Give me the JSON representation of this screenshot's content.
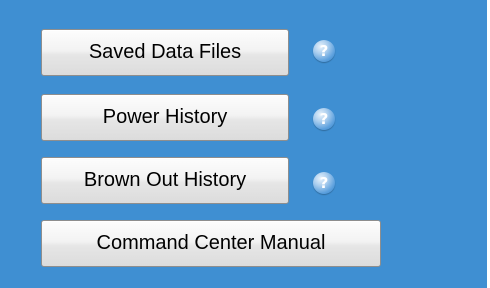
{
  "buttons": {
    "saved_data_files": "Saved Data Files",
    "power_history": "Power History",
    "brown_out_history": "Brown Out History",
    "command_center_manual": "Command Center Manual"
  },
  "help": {
    "glyph": "?",
    "icon": "help-question-icon"
  },
  "colors": {
    "panel_background": "#3f8fd2",
    "help_icon": "#5a9fdd"
  }
}
